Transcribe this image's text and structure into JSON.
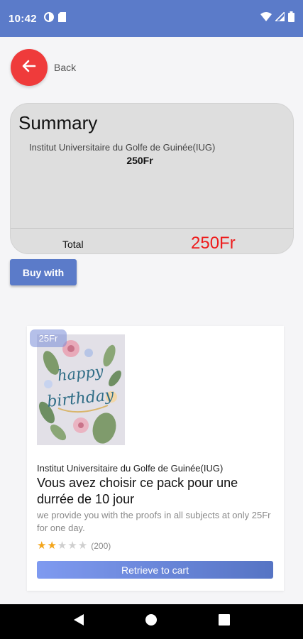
{
  "status_bar": {
    "time": "10:42",
    "left_icons": [
      "data-saver-icon",
      "sim-card-icon"
    ],
    "right_icons": [
      "wifi-icon",
      "signal-icon",
      "battery-icon"
    ]
  },
  "header": {
    "back_label": "Back",
    "back_icon": "arrow-left-icon"
  },
  "summary": {
    "title": "Summary",
    "items": [
      {
        "name": "Institut Universitaire du Golfe de Guinée(IUG)",
        "price": "250Fr"
      }
    ],
    "total_label": "Total",
    "total_value": "250Fr"
  },
  "buy_button_label": "Buy with",
  "product": {
    "price_badge": "25Fr",
    "image_text": "happy birthday",
    "institution": "Institut Universitaire du Golfe de Guinée(IUG)",
    "title": "Vous avez choisir ce pack pour une durrée de 10 jour",
    "description": "we provide you with the proofs in all subjects at only 25Fr for one day.",
    "rating": 2,
    "rating_max": 5,
    "rating_count": "(200)",
    "cart_button_label": "Retrieve to cart"
  },
  "nav_bar": {
    "buttons": [
      "back-triangle-icon",
      "home-circle-icon",
      "recents-square-icon"
    ]
  },
  "colors": {
    "primary": "#5b7bc9",
    "accent_red": "#ef3b3b",
    "total_red": "#ee1c1c",
    "star": "#f3a51b"
  }
}
